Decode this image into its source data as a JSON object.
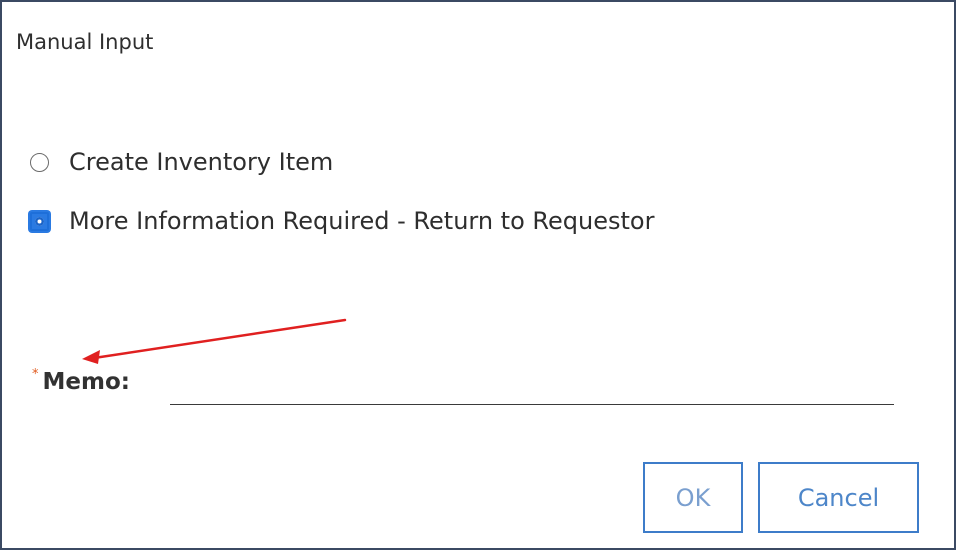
{
  "dialog": {
    "title": "Manual Input"
  },
  "options": [
    {
      "label": "Create Inventory Item",
      "selected": false
    },
    {
      "label": "More Information Required - Return to Requestor",
      "selected": true
    }
  ],
  "memo": {
    "required_mark": "*",
    "label": "Memo:",
    "value": ""
  },
  "buttons": {
    "ok_label": "OK",
    "cancel_label": "Cancel"
  },
  "colors": {
    "accent": "#2a7ae2",
    "button_border": "#3d7cc9",
    "required": "#e05a1e",
    "annotation_arrow": "#e02020"
  }
}
